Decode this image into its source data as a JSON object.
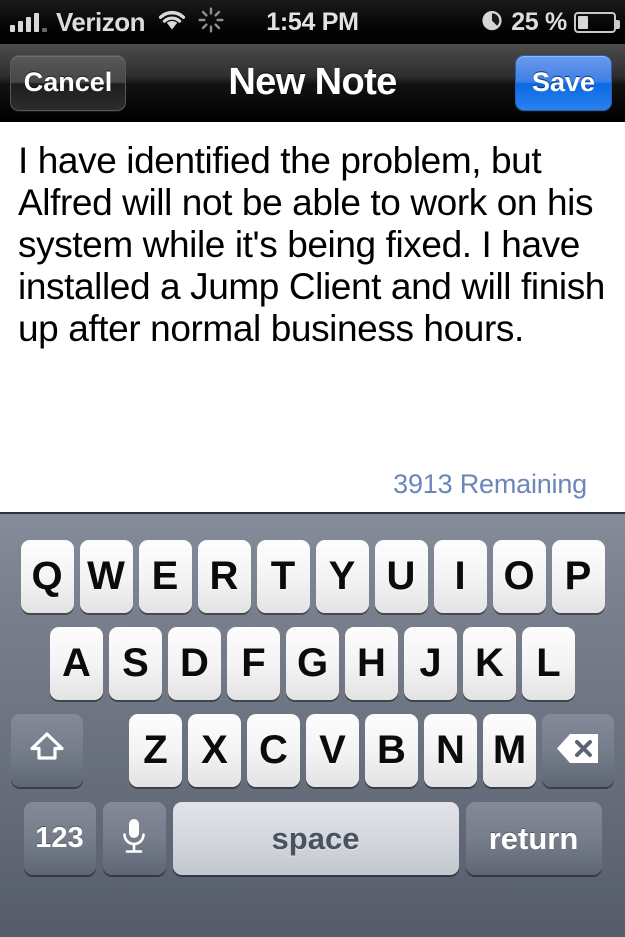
{
  "status_bar": {
    "carrier": "Verizon",
    "time": "1:54 PM",
    "battery_percent_label": "25 %",
    "battery_level": 25,
    "signal_bars_filled": 4,
    "signal_bars_total": 5,
    "icons": [
      "signal-bars-icon",
      "wifi-icon",
      "network-activity-icon",
      "alarm-clock-icon",
      "battery-icon"
    ]
  },
  "nav_bar": {
    "title": "New Note",
    "cancel_label": "Cancel",
    "save_label": "Save",
    "save_color": "#2a81ef",
    "cancel_color": "#3a3a3a"
  },
  "note": {
    "body": "I have identified the problem, but Alfred will not be able to work on his system while it's being fixed. I have installed a Jump Client and will finish up after normal business hours.",
    "remaining_label": "3913 Remaining",
    "remaining_count": 3913,
    "remaining_color": "#6b86b8"
  },
  "keyboard": {
    "layout": "qwerty-uppercase",
    "row1": [
      "Q",
      "W",
      "E",
      "R",
      "T",
      "Y",
      "U",
      "I",
      "O",
      "P"
    ],
    "row2": [
      "A",
      "S",
      "D",
      "F",
      "G",
      "H",
      "J",
      "K",
      "L"
    ],
    "row3": [
      "Z",
      "X",
      "C",
      "V",
      "B",
      "N",
      "M"
    ],
    "shift_icon": "shift-arrow-icon",
    "backspace_icon": "backspace-delete-icon",
    "numeric_label": "123",
    "dictation_icon": "microphone-icon",
    "space_label": "space",
    "return_label": "return",
    "background_color": "#6a717f",
    "key_color": "#f4f4f4"
  }
}
